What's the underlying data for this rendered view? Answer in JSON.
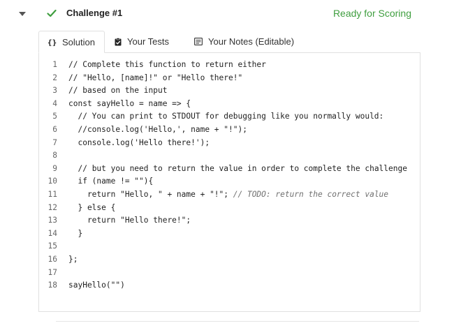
{
  "header": {
    "title": "Challenge #1",
    "status": "Ready for Scoring",
    "status_color": "#3f9e3f",
    "check_icon": "check-icon",
    "caret_icon": "caret-down-icon"
  },
  "tabs": [
    {
      "label": "Solution",
      "icon": "braces-icon",
      "active": true
    },
    {
      "label": "Your Tests",
      "icon": "clipboard-icon",
      "active": false
    },
    {
      "label": "Your Notes (Editable)",
      "icon": "notes-icon",
      "active": false
    }
  ],
  "code": [
    {
      "n": "1",
      "text": "// Complete this function to return either"
    },
    {
      "n": "2",
      "text": "// \"Hello, [name]!\" or \"Hello there!\""
    },
    {
      "n": "3",
      "text": "// based on the input"
    },
    {
      "n": "4",
      "text": "const sayHello = name => {"
    },
    {
      "n": "5",
      "text": "  // You can print to STDOUT for debugging like you normally would:"
    },
    {
      "n": "6",
      "text": "  //console.log('Hello,', name + \"!\");"
    },
    {
      "n": "7",
      "text": "  console.log('Hello there!');"
    },
    {
      "n": "8",
      "text": ""
    },
    {
      "n": "9",
      "text": "  // but you need to return the value in order to complete the challenge"
    },
    {
      "n": "10",
      "text": "  if (name != \"\"){"
    },
    {
      "n": "11",
      "text": "    return \"Hello, \" + name + \"!\"; // TODO: return the correct value"
    },
    {
      "n": "12",
      "text": "  } else {"
    },
    {
      "n": "13",
      "text": "    return \"Hello there!\";"
    },
    {
      "n": "14",
      "text": "  }"
    },
    {
      "n": "15",
      "text": ""
    },
    {
      "n": "16",
      "text": "};"
    },
    {
      "n": "17",
      "text": ""
    },
    {
      "n": "18",
      "text": "sayHello(\"\")"
    }
  ]
}
